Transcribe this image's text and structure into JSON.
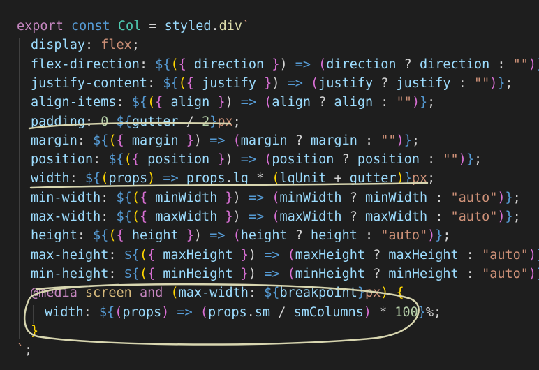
{
  "editor": {
    "lines": [
      {
        "tokens": [
          [
            "kw2",
            "export"
          ],
          [
            "punc",
            " "
          ],
          [
            "kw",
            "const"
          ],
          [
            "punc",
            " "
          ],
          [
            "cls",
            "Col"
          ],
          [
            "punc",
            " = "
          ],
          [
            "var",
            "styled"
          ],
          [
            "punc",
            "."
          ],
          [
            "fn",
            "div"
          ],
          [
            "tmpl",
            "`"
          ]
        ]
      },
      {
        "tokens": [
          [
            "prop",
            "display"
          ],
          [
            "punc",
            ": "
          ],
          [
            "val",
            "flex"
          ],
          [
            "punc",
            ";"
          ]
        ]
      },
      {
        "tokens": [
          [
            "prop",
            "flex-direction"
          ],
          [
            "punc",
            ": "
          ],
          [
            "interp",
            "${"
          ],
          [
            "br1",
            "("
          ],
          [
            "br2",
            "{"
          ],
          [
            "punc",
            " "
          ],
          [
            "var",
            "direction"
          ],
          [
            "punc",
            " "
          ],
          [
            "br2",
            "}"
          ],
          [
            "punc",
            ") "
          ],
          [
            "arrow",
            "=>"
          ],
          [
            "punc",
            " "
          ],
          [
            "br2",
            "("
          ],
          [
            "var",
            "direction"
          ],
          [
            "punc",
            " ? "
          ],
          [
            "var",
            "direction"
          ],
          [
            "punc",
            " : "
          ],
          [
            "str",
            "\"\""
          ],
          [
            "br2",
            ")"
          ],
          [
            "interp",
            "}"
          ],
          [
            "punc",
            ";"
          ]
        ]
      },
      {
        "tokens": [
          [
            "prop",
            "justify-content"
          ],
          [
            "punc",
            ": "
          ],
          [
            "interp",
            "${"
          ],
          [
            "br1",
            "("
          ],
          [
            "br2",
            "{"
          ],
          [
            "punc",
            " "
          ],
          [
            "var",
            "justify"
          ],
          [
            "punc",
            " "
          ],
          [
            "br2",
            "}"
          ],
          [
            "punc",
            ") "
          ],
          [
            "arrow",
            "=>"
          ],
          [
            "punc",
            " "
          ],
          [
            "br2",
            "("
          ],
          [
            "var",
            "justify"
          ],
          [
            "punc",
            " ? "
          ],
          [
            "var",
            "justify"
          ],
          [
            "punc",
            " : "
          ],
          [
            "str",
            "\"\""
          ],
          [
            "br2",
            ")"
          ],
          [
            "interp",
            "}"
          ],
          [
            "punc",
            ";"
          ]
        ]
      },
      {
        "tokens": [
          [
            "prop",
            "align-items"
          ],
          [
            "punc",
            ": "
          ],
          [
            "interp",
            "${"
          ],
          [
            "br1",
            "("
          ],
          [
            "br2",
            "{"
          ],
          [
            "punc",
            " "
          ],
          [
            "var",
            "align"
          ],
          [
            "punc",
            " "
          ],
          [
            "br2",
            "}"
          ],
          [
            "punc",
            ") "
          ],
          [
            "arrow",
            "=>"
          ],
          [
            "punc",
            " "
          ],
          [
            "br2",
            "("
          ],
          [
            "var",
            "align"
          ],
          [
            "punc",
            " ? "
          ],
          [
            "var",
            "align"
          ],
          [
            "punc",
            " : "
          ],
          [
            "str",
            "\"\""
          ],
          [
            "br2",
            ")"
          ],
          [
            "interp",
            "}"
          ],
          [
            "punc",
            ";"
          ]
        ]
      },
      {
        "tokens": [
          [
            "prop",
            "padding"
          ],
          [
            "punc",
            ": "
          ],
          [
            "num",
            "0"
          ],
          [
            "punc",
            " "
          ],
          [
            "interp",
            "${"
          ],
          [
            "var",
            "gutter"
          ],
          [
            "punc",
            " / "
          ],
          [
            "num",
            "2"
          ],
          [
            "interp",
            "}"
          ],
          [
            "val",
            "px"
          ],
          [
            "punc",
            ";"
          ]
        ]
      },
      {
        "tokens": [
          [
            "prop",
            "margin"
          ],
          [
            "punc",
            ": "
          ],
          [
            "interp",
            "${"
          ],
          [
            "br1",
            "("
          ],
          [
            "br2",
            "{"
          ],
          [
            "punc",
            " "
          ],
          [
            "var",
            "margin"
          ],
          [
            "punc",
            " "
          ],
          [
            "br2",
            "}"
          ],
          [
            "punc",
            ") "
          ],
          [
            "arrow",
            "=>"
          ],
          [
            "punc",
            " "
          ],
          [
            "br2",
            "("
          ],
          [
            "var",
            "margin"
          ],
          [
            "punc",
            " ? "
          ],
          [
            "var",
            "margin"
          ],
          [
            "punc",
            " : "
          ],
          [
            "str",
            "\"\""
          ],
          [
            "br2",
            ")"
          ],
          [
            "interp",
            "}"
          ],
          [
            "punc",
            ";"
          ]
        ]
      },
      {
        "tokens": [
          [
            "prop",
            "position"
          ],
          [
            "punc",
            ": "
          ],
          [
            "interp",
            "${"
          ],
          [
            "br1",
            "("
          ],
          [
            "br2",
            "{"
          ],
          [
            "punc",
            " "
          ],
          [
            "var",
            "position"
          ],
          [
            "punc",
            " "
          ],
          [
            "br2",
            "}"
          ],
          [
            "punc",
            ") "
          ],
          [
            "arrow",
            "=>"
          ],
          [
            "punc",
            " "
          ],
          [
            "br2",
            "("
          ],
          [
            "var",
            "position"
          ],
          [
            "punc",
            " ? "
          ],
          [
            "var",
            "position"
          ],
          [
            "punc",
            " : "
          ],
          [
            "str",
            "\"\""
          ],
          [
            "br2",
            ")"
          ],
          [
            "interp",
            "}"
          ],
          [
            "punc",
            ";"
          ]
        ]
      },
      {
        "tokens": [
          [
            "prop",
            "width"
          ],
          [
            "punc",
            ": "
          ],
          [
            "interp",
            "${"
          ],
          [
            "br1",
            "("
          ],
          [
            "var",
            "props"
          ],
          [
            "br1",
            ")"
          ],
          [
            "punc",
            " "
          ],
          [
            "arrow",
            "=>"
          ],
          [
            "punc",
            " "
          ],
          [
            "var",
            "props"
          ],
          [
            "punc",
            "."
          ],
          [
            "var",
            "lg"
          ],
          [
            "punc",
            " * "
          ],
          [
            "br1",
            "("
          ],
          [
            "var",
            "lgUnit"
          ],
          [
            "punc",
            " + "
          ],
          [
            "var",
            "gutter"
          ],
          [
            "br1",
            ")"
          ],
          [
            "interp",
            "}"
          ],
          [
            "val",
            "px"
          ],
          [
            "punc",
            ";"
          ]
        ]
      },
      {
        "tokens": [
          [
            "prop",
            "min-width"
          ],
          [
            "punc",
            ": "
          ],
          [
            "interp",
            "${"
          ],
          [
            "br1",
            "("
          ],
          [
            "br2",
            "{"
          ],
          [
            "punc",
            " "
          ],
          [
            "var",
            "minWidth"
          ],
          [
            "punc",
            " "
          ],
          [
            "br2",
            "}"
          ],
          [
            "punc",
            ") "
          ],
          [
            "arrow",
            "=>"
          ],
          [
            "punc",
            " "
          ],
          [
            "br2",
            "("
          ],
          [
            "var",
            "minWidth"
          ],
          [
            "punc",
            " ? "
          ],
          [
            "var",
            "minWidth"
          ],
          [
            "punc",
            " : "
          ],
          [
            "str",
            "\"auto\""
          ],
          [
            "br2",
            ")"
          ],
          [
            "interp",
            "}"
          ],
          [
            "punc",
            ";"
          ]
        ]
      },
      {
        "tokens": [
          [
            "prop",
            "max-width"
          ],
          [
            "punc",
            ": "
          ],
          [
            "interp",
            "${"
          ],
          [
            "br1",
            "("
          ],
          [
            "br2",
            "{"
          ],
          [
            "punc",
            " "
          ],
          [
            "var",
            "maxWidth"
          ],
          [
            "punc",
            " "
          ],
          [
            "br2",
            "}"
          ],
          [
            "punc",
            ") "
          ],
          [
            "arrow",
            "=>"
          ],
          [
            "punc",
            " "
          ],
          [
            "br2",
            "("
          ],
          [
            "var",
            "maxWidth"
          ],
          [
            "punc",
            " ? "
          ],
          [
            "var",
            "maxWidth"
          ],
          [
            "punc",
            " : "
          ],
          [
            "str",
            "\"auto\""
          ],
          [
            "br2",
            ")"
          ],
          [
            "interp",
            "}"
          ],
          [
            "punc",
            ";"
          ]
        ]
      },
      {
        "tokens": [
          [
            "prop",
            "height"
          ],
          [
            "punc",
            ": "
          ],
          [
            "interp",
            "${"
          ],
          [
            "br1",
            "("
          ],
          [
            "br2",
            "{"
          ],
          [
            "punc",
            " "
          ],
          [
            "var",
            "height"
          ],
          [
            "punc",
            " "
          ],
          [
            "br2",
            "}"
          ],
          [
            "punc",
            ") "
          ],
          [
            "arrow",
            "=>"
          ],
          [
            "punc",
            " "
          ],
          [
            "br2",
            "("
          ],
          [
            "var",
            "height"
          ],
          [
            "punc",
            " ? "
          ],
          [
            "var",
            "height"
          ],
          [
            "punc",
            " : "
          ],
          [
            "str",
            "\"auto\""
          ],
          [
            "br2",
            ")"
          ],
          [
            "interp",
            "}"
          ],
          [
            "punc",
            ";"
          ]
        ]
      },
      {
        "tokens": [
          [
            "prop",
            "max-height"
          ],
          [
            "punc",
            ": "
          ],
          [
            "interp",
            "${"
          ],
          [
            "br1",
            "("
          ],
          [
            "br2",
            "{"
          ],
          [
            "punc",
            " "
          ],
          [
            "var",
            "maxHeight"
          ],
          [
            "punc",
            " "
          ],
          [
            "br2",
            "}"
          ],
          [
            "punc",
            ") "
          ],
          [
            "arrow",
            "=>"
          ],
          [
            "punc",
            " "
          ],
          [
            "br2",
            "("
          ],
          [
            "var",
            "maxHeight"
          ],
          [
            "punc",
            " ? "
          ],
          [
            "var",
            "maxHeight"
          ],
          [
            "punc",
            " : "
          ],
          [
            "str",
            "\"auto\""
          ],
          [
            "br2",
            ")"
          ],
          [
            "interp",
            "}"
          ],
          [
            "punc",
            ";"
          ]
        ]
      },
      {
        "tokens": [
          [
            "prop",
            "min-height"
          ],
          [
            "punc",
            ": "
          ],
          [
            "interp",
            "${"
          ],
          [
            "br1",
            "("
          ],
          [
            "br2",
            "{"
          ],
          [
            "punc",
            " "
          ],
          [
            "var",
            "minHeight"
          ],
          [
            "punc",
            " "
          ],
          [
            "br2",
            "}"
          ],
          [
            "punc",
            ") "
          ],
          [
            "arrow",
            "=>"
          ],
          [
            "punc",
            " "
          ],
          [
            "br2",
            "("
          ],
          [
            "var",
            "minHeight"
          ],
          [
            "punc",
            " ? "
          ],
          [
            "var",
            "minHeight"
          ],
          [
            "punc",
            " : "
          ],
          [
            "str",
            "\"auto\""
          ],
          [
            "br2",
            ")"
          ],
          [
            "interp",
            "}"
          ],
          [
            "punc",
            ";"
          ]
        ]
      },
      {
        "tokens": [
          [
            "media",
            "@media"
          ],
          [
            "punc",
            " "
          ],
          [
            "mediaid",
            "screen"
          ],
          [
            "punc",
            " "
          ],
          [
            "media",
            "and"
          ],
          [
            "punc",
            " "
          ],
          [
            "br1",
            "("
          ],
          [
            "prop",
            "max-width"
          ],
          [
            "punc",
            ": "
          ],
          [
            "interp",
            "${"
          ],
          [
            "var",
            "breakpoint"
          ],
          [
            "interp",
            "}"
          ],
          [
            "val",
            "px"
          ],
          [
            "br1",
            ")"
          ],
          [
            "punc",
            " "
          ],
          [
            "br1",
            "{"
          ]
        ]
      },
      {
        "tokens": [
          [
            "prop",
            "width"
          ],
          [
            "punc",
            ": "
          ],
          [
            "interp",
            "${"
          ],
          [
            "br2",
            "("
          ],
          [
            "var",
            "props"
          ],
          [
            "br2",
            ")"
          ],
          [
            "punc",
            " "
          ],
          [
            "arrow",
            "=>"
          ],
          [
            "punc",
            " "
          ],
          [
            "br2",
            "("
          ],
          [
            "var",
            "props"
          ],
          [
            "punc",
            "."
          ],
          [
            "var",
            "sm"
          ],
          [
            "punc",
            " / "
          ],
          [
            "var",
            "smColumns"
          ],
          [
            "br2",
            ")"
          ],
          [
            "punc",
            " * "
          ],
          [
            "num",
            "100"
          ],
          [
            "interp",
            "}"
          ],
          [
            "punc",
            "%;"
          ]
        ]
      },
      {
        "tokens": [
          [
            "br1",
            "}"
          ]
        ]
      },
      {
        "tokens": [
          [
            "tmpl",
            "`"
          ],
          [
            "punc",
            ";"
          ]
        ]
      }
    ]
  },
  "colors": {
    "background": "#1e1e1e",
    "annotation": "#d8d6b0"
  }
}
